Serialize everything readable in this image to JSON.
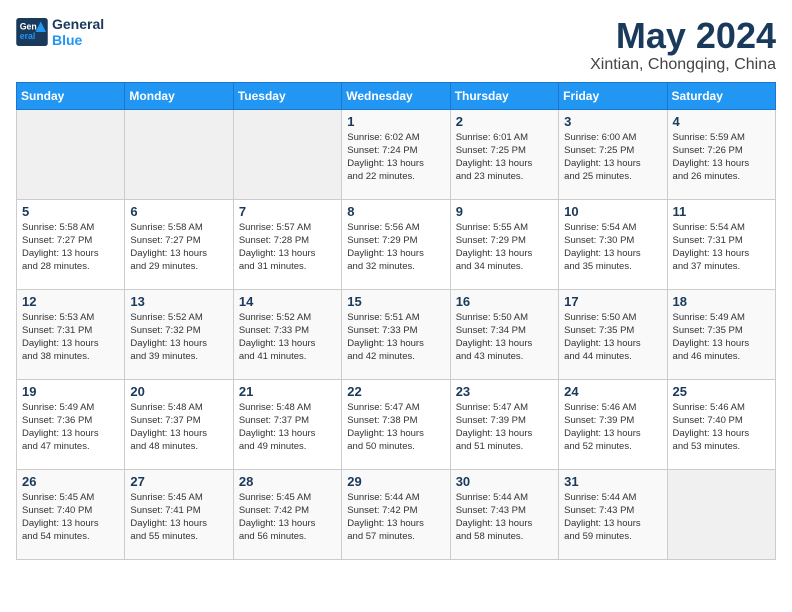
{
  "header": {
    "logo_line1": "General",
    "logo_line2": "Blue",
    "title": "May 2024",
    "subtitle": "Xintian, Chongqing, China"
  },
  "weekdays": [
    "Sunday",
    "Monday",
    "Tuesday",
    "Wednesday",
    "Thursday",
    "Friday",
    "Saturday"
  ],
  "weeks": [
    [
      {
        "day": "",
        "info": ""
      },
      {
        "day": "",
        "info": ""
      },
      {
        "day": "",
        "info": ""
      },
      {
        "day": "1",
        "info": "Sunrise: 6:02 AM\nSunset: 7:24 PM\nDaylight: 13 hours\nand 22 minutes."
      },
      {
        "day": "2",
        "info": "Sunrise: 6:01 AM\nSunset: 7:25 PM\nDaylight: 13 hours\nand 23 minutes."
      },
      {
        "day": "3",
        "info": "Sunrise: 6:00 AM\nSunset: 7:25 PM\nDaylight: 13 hours\nand 25 minutes."
      },
      {
        "day": "4",
        "info": "Sunrise: 5:59 AM\nSunset: 7:26 PM\nDaylight: 13 hours\nand 26 minutes."
      }
    ],
    [
      {
        "day": "5",
        "info": "Sunrise: 5:58 AM\nSunset: 7:27 PM\nDaylight: 13 hours\nand 28 minutes."
      },
      {
        "day": "6",
        "info": "Sunrise: 5:58 AM\nSunset: 7:27 PM\nDaylight: 13 hours\nand 29 minutes."
      },
      {
        "day": "7",
        "info": "Sunrise: 5:57 AM\nSunset: 7:28 PM\nDaylight: 13 hours\nand 31 minutes."
      },
      {
        "day": "8",
        "info": "Sunrise: 5:56 AM\nSunset: 7:29 PM\nDaylight: 13 hours\nand 32 minutes."
      },
      {
        "day": "9",
        "info": "Sunrise: 5:55 AM\nSunset: 7:29 PM\nDaylight: 13 hours\nand 34 minutes."
      },
      {
        "day": "10",
        "info": "Sunrise: 5:54 AM\nSunset: 7:30 PM\nDaylight: 13 hours\nand 35 minutes."
      },
      {
        "day": "11",
        "info": "Sunrise: 5:54 AM\nSunset: 7:31 PM\nDaylight: 13 hours\nand 37 minutes."
      }
    ],
    [
      {
        "day": "12",
        "info": "Sunrise: 5:53 AM\nSunset: 7:31 PM\nDaylight: 13 hours\nand 38 minutes."
      },
      {
        "day": "13",
        "info": "Sunrise: 5:52 AM\nSunset: 7:32 PM\nDaylight: 13 hours\nand 39 minutes."
      },
      {
        "day": "14",
        "info": "Sunrise: 5:52 AM\nSunset: 7:33 PM\nDaylight: 13 hours\nand 41 minutes."
      },
      {
        "day": "15",
        "info": "Sunrise: 5:51 AM\nSunset: 7:33 PM\nDaylight: 13 hours\nand 42 minutes."
      },
      {
        "day": "16",
        "info": "Sunrise: 5:50 AM\nSunset: 7:34 PM\nDaylight: 13 hours\nand 43 minutes."
      },
      {
        "day": "17",
        "info": "Sunrise: 5:50 AM\nSunset: 7:35 PM\nDaylight: 13 hours\nand 44 minutes."
      },
      {
        "day": "18",
        "info": "Sunrise: 5:49 AM\nSunset: 7:35 PM\nDaylight: 13 hours\nand 46 minutes."
      }
    ],
    [
      {
        "day": "19",
        "info": "Sunrise: 5:49 AM\nSunset: 7:36 PM\nDaylight: 13 hours\nand 47 minutes."
      },
      {
        "day": "20",
        "info": "Sunrise: 5:48 AM\nSunset: 7:37 PM\nDaylight: 13 hours\nand 48 minutes."
      },
      {
        "day": "21",
        "info": "Sunrise: 5:48 AM\nSunset: 7:37 PM\nDaylight: 13 hours\nand 49 minutes."
      },
      {
        "day": "22",
        "info": "Sunrise: 5:47 AM\nSunset: 7:38 PM\nDaylight: 13 hours\nand 50 minutes."
      },
      {
        "day": "23",
        "info": "Sunrise: 5:47 AM\nSunset: 7:39 PM\nDaylight: 13 hours\nand 51 minutes."
      },
      {
        "day": "24",
        "info": "Sunrise: 5:46 AM\nSunset: 7:39 PM\nDaylight: 13 hours\nand 52 minutes."
      },
      {
        "day": "25",
        "info": "Sunrise: 5:46 AM\nSunset: 7:40 PM\nDaylight: 13 hours\nand 53 minutes."
      }
    ],
    [
      {
        "day": "26",
        "info": "Sunrise: 5:45 AM\nSunset: 7:40 PM\nDaylight: 13 hours\nand 54 minutes."
      },
      {
        "day": "27",
        "info": "Sunrise: 5:45 AM\nSunset: 7:41 PM\nDaylight: 13 hours\nand 55 minutes."
      },
      {
        "day": "28",
        "info": "Sunrise: 5:45 AM\nSunset: 7:42 PM\nDaylight: 13 hours\nand 56 minutes."
      },
      {
        "day": "29",
        "info": "Sunrise: 5:44 AM\nSunset: 7:42 PM\nDaylight: 13 hours\nand 57 minutes."
      },
      {
        "day": "30",
        "info": "Sunrise: 5:44 AM\nSunset: 7:43 PM\nDaylight: 13 hours\nand 58 minutes."
      },
      {
        "day": "31",
        "info": "Sunrise: 5:44 AM\nSunset: 7:43 PM\nDaylight: 13 hours\nand 59 minutes."
      },
      {
        "day": "",
        "info": ""
      }
    ]
  ]
}
